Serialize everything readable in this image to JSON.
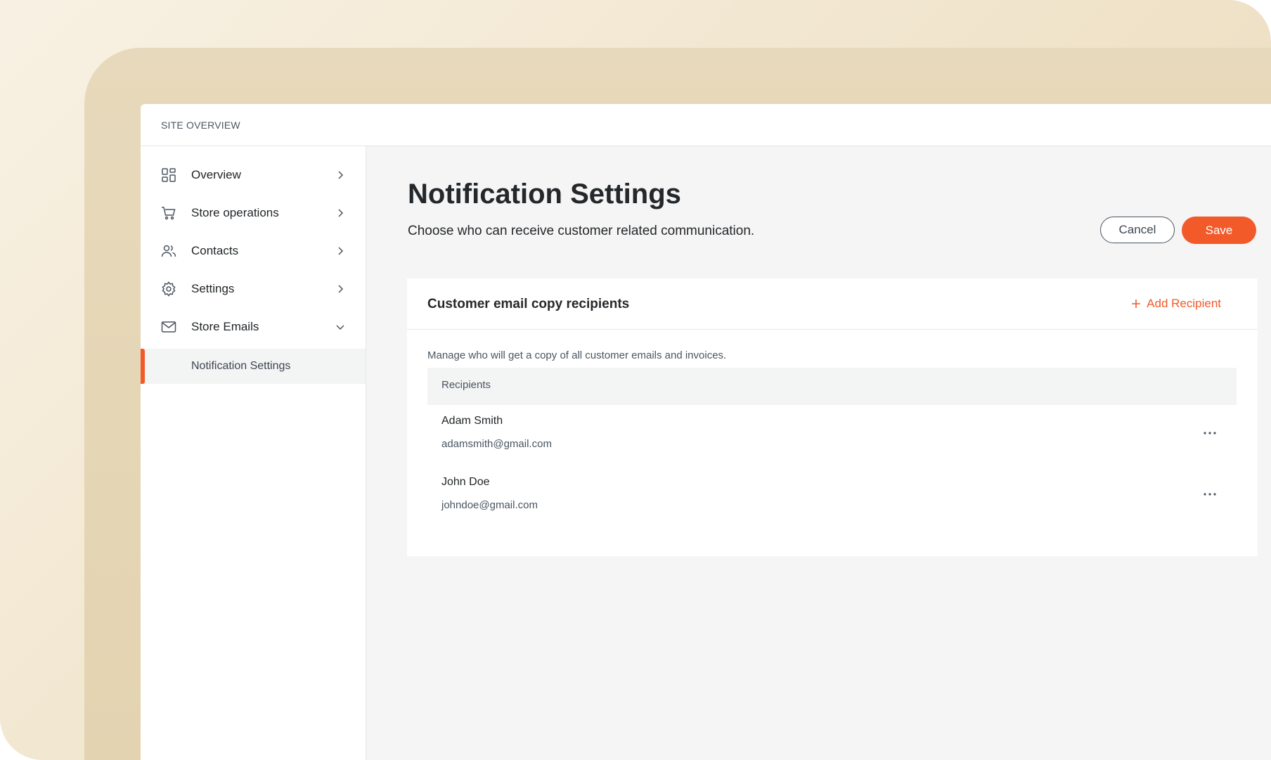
{
  "topbar": {
    "title": "SITE OVERVIEW"
  },
  "sidebar": {
    "items": [
      {
        "label": "Overview",
        "icon": "grid-icon"
      },
      {
        "label": "Store operations",
        "icon": "cart-icon"
      },
      {
        "label": "Contacts",
        "icon": "users-icon"
      },
      {
        "label": "Settings",
        "icon": "gear-icon"
      },
      {
        "label": "Store Emails",
        "icon": "mail-icon",
        "expanded": true
      }
    ],
    "sub_items": [
      {
        "label": "Notification Settings",
        "active": true
      }
    ]
  },
  "main": {
    "title": "Notification Settings",
    "subtitle": "Choose who can receive customer related communication.",
    "cancel_label": "Cancel",
    "save_label": "Save"
  },
  "card": {
    "title": "Customer email copy recipients",
    "add_label": "Add Recipient",
    "description": "Manage who will get a copy of all customer emails and invoices.",
    "column_header": "Recipients",
    "rows": [
      {
        "name": "Adam Smith",
        "email": "adamsmith@gmail.com"
      },
      {
        "name": "John Doe",
        "email": "johndoe@gmail.com"
      }
    ]
  },
  "colors": {
    "accent": "#f25a2a",
    "text": "#25282b",
    "muted": "#4a5560"
  }
}
